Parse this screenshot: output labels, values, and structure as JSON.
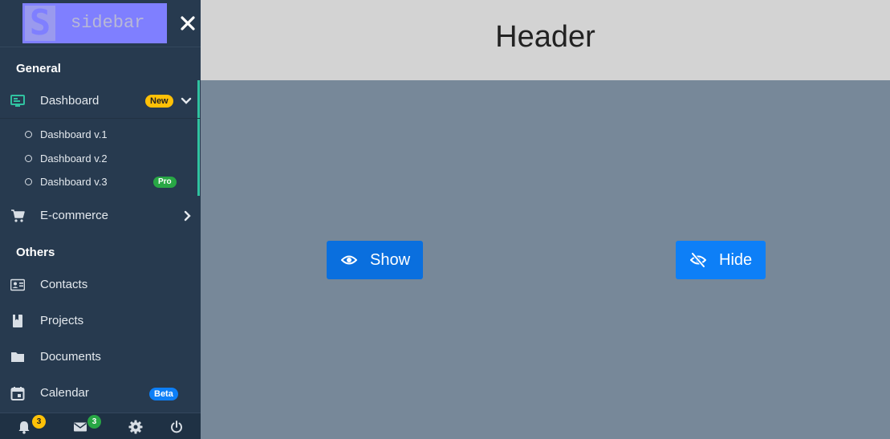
{
  "sidebar": {
    "logo_letter": "S",
    "logo_text": "sidebar",
    "sections": {
      "general": "General",
      "others": "Others"
    },
    "dashboard": {
      "label": "Dashboard",
      "badge": "New",
      "submenu": [
        {
          "label": "Dashboard v.1"
        },
        {
          "label": "Dashboard v.2"
        },
        {
          "label": "Dashboard v.3",
          "badge": "Pro"
        }
      ]
    },
    "ecommerce": {
      "label": "E-commerce"
    },
    "contacts": {
      "label": "Contacts"
    },
    "projects": {
      "label": "Projects"
    },
    "documents": {
      "label": "Documents"
    },
    "calendar": {
      "label": "Calendar",
      "badge": "Beta"
    },
    "footer": {
      "notifications_count": "3",
      "messages_count": "3"
    }
  },
  "header": {
    "title": "Header"
  },
  "main": {
    "show_label": "Show",
    "hide_label": "Hide"
  },
  "colors": {
    "sidebar_bg": "#273a4f",
    "header_bg": "#d3d3d3",
    "main_bg": "#778899",
    "accent": "#30c2a0",
    "badge_new": "#ffc107",
    "badge_pro": "#28a745",
    "badge_beta": "#0d7ff7",
    "button_blue": "#0d7ff7"
  },
  "icons": {
    "close": "close-icon",
    "dashboard": "monitor-icon",
    "ecommerce": "shopping-cart-icon",
    "contacts": "contact-card-icon",
    "projects": "book-icon",
    "documents": "folder-icon",
    "calendar": "calendar-icon",
    "notifications": "bell-icon",
    "messages": "envelope-icon",
    "settings": "gear-icon",
    "power": "power-icon",
    "show": "eye-icon",
    "hide": "eye-slash-icon"
  }
}
